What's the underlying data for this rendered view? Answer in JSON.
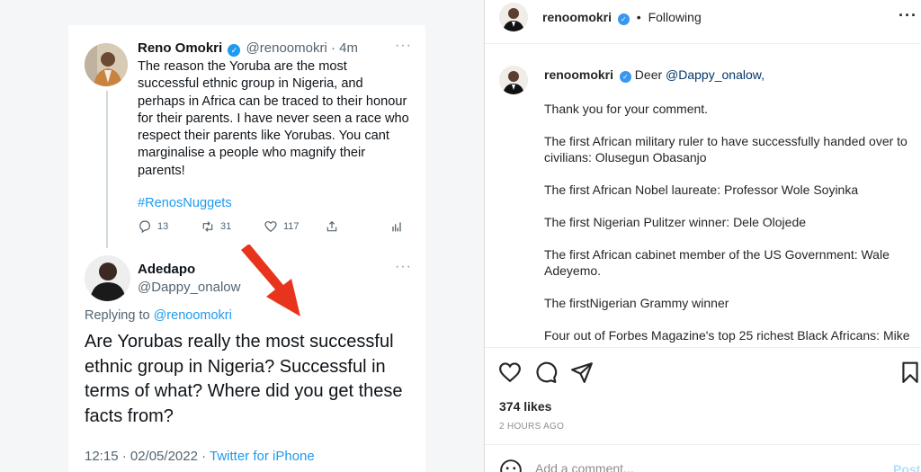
{
  "tweet": {
    "author_name": "Reno Omokri",
    "author_handle_time": "@renoomokri · 4m",
    "body": "The reason the Yoruba are the most successful ethnic group in Nigeria, and perhaps in Africa can be traced to their honour for their parents. I have never seen a race who respect their parents like Yorubas. You cant marginalise a people who magnify their parents!",
    "hashtag": "#RenosNuggets",
    "reply_count": "13",
    "retweet_count": "31",
    "like_count": "117",
    "more": "···"
  },
  "reply": {
    "author_name": "Adedapo",
    "author_handle": "@Dappy_onalow",
    "replying_prefix": "Replying to ",
    "replying_to": "@renoomokri",
    "body": "Are Yorubas really the most successful ethnic group in Nigeria? Successful in terms of what? Where did you get these facts from?",
    "time_date": "12:15 · 02/05/2022 · ",
    "source": "Twitter for iPhone",
    "more": "···"
  },
  "instagram": {
    "username": "renoomokri",
    "dot": "•",
    "following": "Following",
    "more": "···",
    "caption_user": "renoomokri",
    "caption_greeting": "Deer ",
    "caption_mention": "@Dappy_onalow,",
    "caption_paragraphs": [
      "Thank you for your comment.",
      "The first African military ruler to have successfully handed over to civilians: Olusegun Obasanjo",
      "The first African Nobel laureate: Professor Wole Soyinka",
      "The first Nigerian Pulitzer winner: Dele Olojede",
      "The first African cabinet member of the US Government: Wale Adeyemo.",
      "The firstNigerian Grammy winner",
      "Four out of Forbes Magazine's top 25 richest Black Africans: Mike"
    ],
    "likes": "374 likes",
    "time_ago": "2 HOURS AGO",
    "comment_placeholder": "Add a comment...",
    "post_label": "Post"
  },
  "colors": {
    "twitter_blue": "#1d9bf0",
    "annotation_red": "#e8341c",
    "ig_link": "#00376b"
  }
}
